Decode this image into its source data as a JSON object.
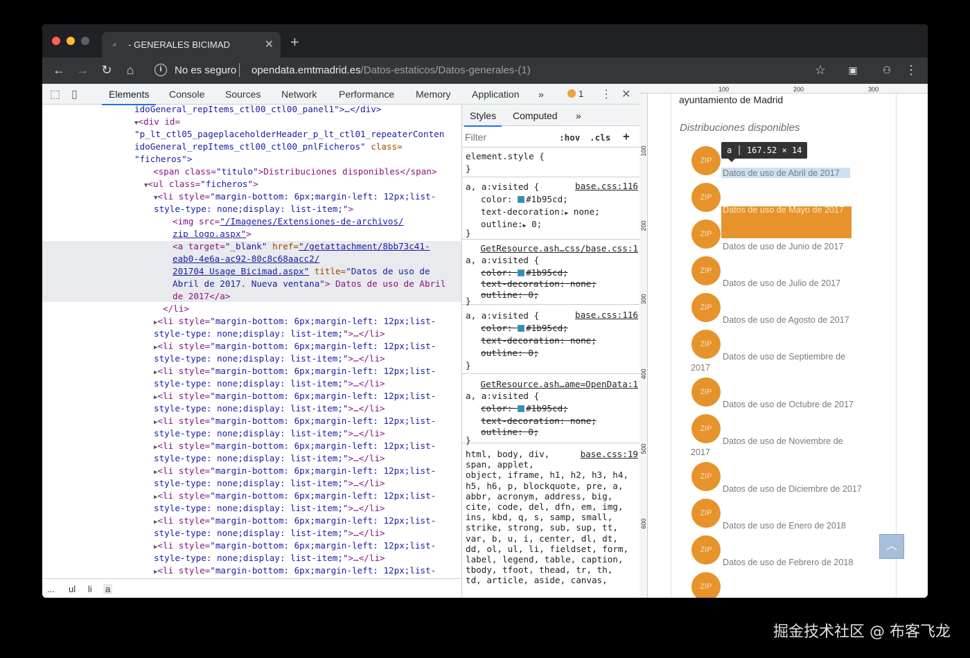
{
  "browser": {
    "tab_title": "- GENERALES BICIMAD",
    "security_text": "No es seguro",
    "url_host": "opendata.emtmadrid.es",
    "url_path": "/Datos-estaticos/Datos-generales-(1)"
  },
  "devtools": {
    "tabs": [
      "Elements",
      "Console",
      "Sources",
      "Network",
      "Performance",
      "Memory",
      "Application"
    ],
    "active_tab": "Elements",
    "more_tabs": "»",
    "warning_count": "1",
    "breadcrumbs": [
      "...",
      "ul",
      "li",
      "a"
    ],
    "styles_tabs": [
      "Styles",
      "Computed"
    ],
    "filter_placeholder": "Filter",
    "hov": ":hov",
    "cls": ".cls",
    "plus": "+"
  },
  "dom": {
    "line0": "idoGeneral_repItems_ctl00_ctl00_panel1\">…</div>",
    "line1_tag": "<div id=",
    "line2": "\"p_lt_ctl05_pageplaceholderHeader_p_lt_ctl01_repeaterConten",
    "line3_a": "idoGeneral_repItems_ctl00_ctl00_pnlFicheros\"",
    "line3_b": " class=",
    "line4": "\"ficheros\">",
    "line5_a": "<span class=",
    "line5_b": "\"titulo\"",
    "line5_c": ">Distribuciones disponibles</span>",
    "line6_a": "<ul class=",
    "line6_b": "\"ficheros\"",
    "line6_c": ">",
    "li_open_a": "<li style=",
    "li_open_b": "\"margin-bottom: 6px;margin-left: 12px;list-",
    "li_open_c": "style-type: none;display: list-item;\"",
    "li_open_d": ">",
    "img_a": "<img src=",
    "img_b": "\"/Imagenes/Extensiones-de-archivos/",
    "img_c": "zip logo.aspx\"",
    "img_d": ">",
    "a_1": "<a target=",
    "a_2": "\"_blank\"",
    "a_3": " href=",
    "a_4": "\"/getattachment/8bb73c41-",
    "a_5": "eab0-4e6a-ac92-80c8c68aacc2/",
    "a_6": "201704 Usage Bicimad.aspx\"",
    "a_7": " title=",
    "a_8": "\"Datos de uso de",
    "a_9": "Abril de 2017. Nueva ventana\"",
    "a_10": "> Datos de uso de Abril",
    "a_11": "de 2017</a>",
    "li_close": "</li>",
    "li_collapsed_b": "\"margin-bottom: 6px;margin-left: 12px;list-",
    "li_collapsed_c": "style-type: none;display: list-item;\"",
    "li_collapsed_d": ">…</li>"
  },
  "styles": {
    "element_style": "element.style {",
    "close_brace": "}",
    "selector": "a, a:visited {",
    "base_css_116": "base.css:116",
    "getresource_1": "GetResource.ash…css/base.css:1",
    "getresource_2": "GetResource.ash…ame=OpenData:1",
    "base_css_19": "base.css:19",
    "color_prop": "color:",
    "color_val": "#1b95cd;",
    "td_prop": "text-decoration:",
    "td_val": "none;",
    "outline_prop": "outline:",
    "outline_val": "0;",
    "html_selector": "html, body, div,\nspan, applet,\nobject, iframe, h1, h2, h3, h4,\nh5, h6, p, blockquote, pre, a,\nabbr, acronym, address, big,\ncite, code, del, dfn, em, img,\nins, kbd, q, s, samp, small,\nstrike, strong, sub, sup, tt,\nvar, b, u, i, center, dl, dt,\ndd, ol, ul, li, fieldset, form,\nlabel, legend, table, caption,\ntbody, tfoot, thead, tr, th,\ntd, article, aside, canvas,"
  },
  "page": {
    "ruler_top": [
      "100",
      "200",
      "300"
    ],
    "ruler_left": [
      "100",
      "200",
      "300",
      "400",
      "500",
      "600"
    ],
    "org": "ayuntamiento de Madrid",
    "dist_title": "Distribuciones disponibles",
    "zip_label": "ZIP",
    "tooltip_tag": "a",
    "tooltip_size": "167.52 × 14",
    "scroll_top_icon": "chevron-up",
    "datasets": [
      "Datos de uso de Abril de 2017",
      "Datos de uso de Mayo de 2017",
      "Datos de uso de Junio de 2017",
      "Datos de uso de Julio de 2017",
      "Datos de uso de Agosto de 2017",
      "Datos de uso de Septiembre de",
      "Datos de uso de Octubre de 2017",
      "Datos de uso de Noviembre de",
      "Datos de uso de Diciembre de 2017",
      "Datos de uso de Enero de 2018",
      "Datos de uso de Febrero de 2018"
    ],
    "wrap_2017": "2017"
  },
  "watermark": "掘金技术社区 @ 布客飞龙",
  "colors": {
    "accent": "#1a73e8",
    "zip": "#e6932b",
    "link": "#1b95cd"
  }
}
